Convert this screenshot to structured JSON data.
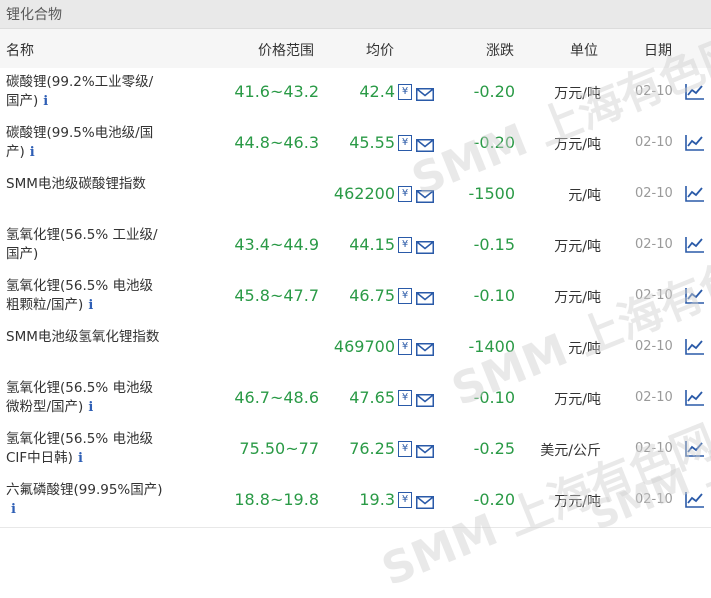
{
  "title": "锂化合物",
  "headers": {
    "name": "名称",
    "price_range": "价格范围",
    "avg": "均价",
    "change": "涨跌",
    "unit": "单位",
    "date": "日期"
  },
  "info_symbol": "i",
  "calendar_char": "¥",
  "watermark": {
    "brand": "SMM",
    "text": "上海有色网"
  },
  "rows": [
    {
      "name": "碳酸锂(99.2%工业零级/国产)",
      "range": "41.6~43.2",
      "avg": "42.4",
      "change": "-0.20",
      "unit": "万元/吨",
      "date": "02-10"
    },
    {
      "name": "碳酸锂(99.5%电池级/国产)",
      "range": "44.8~46.3",
      "avg": "45.55",
      "change": "-0.20",
      "unit": "万元/吨",
      "date": "02-10"
    },
    {
      "name": "SMM电池级碳酸锂指数",
      "range": "",
      "avg": "462200",
      "change": "-1500",
      "unit": "元/吨",
      "date": "02-10"
    },
    {
      "name": "氢氧化锂(56.5% 工业级/国产)",
      "range": "43.4~44.9",
      "avg": "44.15",
      "change": "-0.15",
      "unit": "万元/吨",
      "date": "02-10"
    },
    {
      "name": "氢氧化锂(56.5% 电池级粗颗粒/国产)",
      "range": "45.8~47.7",
      "avg": "46.75",
      "change": "-0.10",
      "unit": "万元/吨",
      "date": "02-10"
    },
    {
      "name": "SMM电池级氢氧化锂指数",
      "range": "",
      "avg": "469700",
      "change": "-1400",
      "unit": "元/吨",
      "date": "02-10"
    },
    {
      "name": "氢氧化锂(56.5% 电池级微粉型/国产)",
      "range": "46.7~48.6",
      "avg": "47.65",
      "change": "-0.10",
      "unit": "万元/吨",
      "date": "02-10"
    },
    {
      "name": "氢氧化锂(56.5% 电池级CIF中日韩)",
      "range": "75.50~77",
      "avg": "76.25",
      "change": "-0.25",
      "unit": "美元/公斤",
      "date": "02-10"
    },
    {
      "name": "六氟磷酸锂(99.95%国产)",
      "range": "18.8~19.8",
      "avg": "19.3",
      "change": "-0.20",
      "unit": "万元/吨",
      "date": "02-10"
    }
  ],
  "rows_with_info": [
    true,
    true,
    false,
    false,
    true,
    false,
    true,
    true,
    true
  ],
  "colors": {
    "price_green": "#2a9a46",
    "info_blue": "#2f5fb5",
    "header_bg": "#f6f6f6",
    "title_bg": "#e9e9e9"
  }
}
